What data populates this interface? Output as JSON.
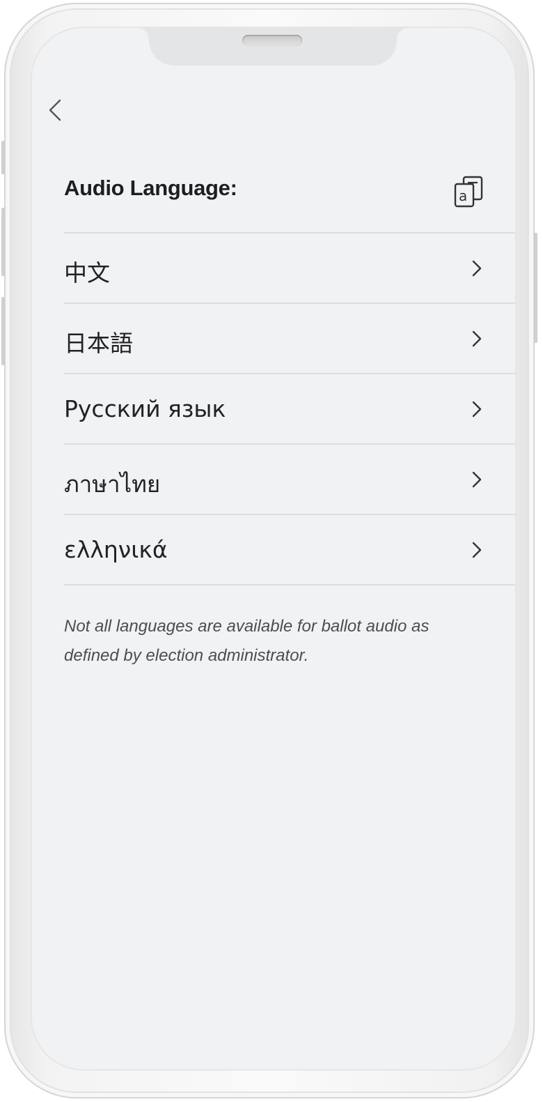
{
  "header": {
    "title": "Audio Language:",
    "back_icon": "chevron-left-icon",
    "translate_icon": "translate-icon"
  },
  "languages": [
    {
      "label": "中文"
    },
    {
      "label": "日本語"
    },
    {
      "label": "Русский язык"
    },
    {
      "label": "ภาษาไทย"
    },
    {
      "label": "ελληνικά"
    }
  ],
  "note": "Not all languages are available for ballot audio as defined by election administrator.",
  "colors": {
    "screen_bg": "#f1f2f4",
    "text": "#1e1e1e",
    "divider": "#dcdde0"
  }
}
